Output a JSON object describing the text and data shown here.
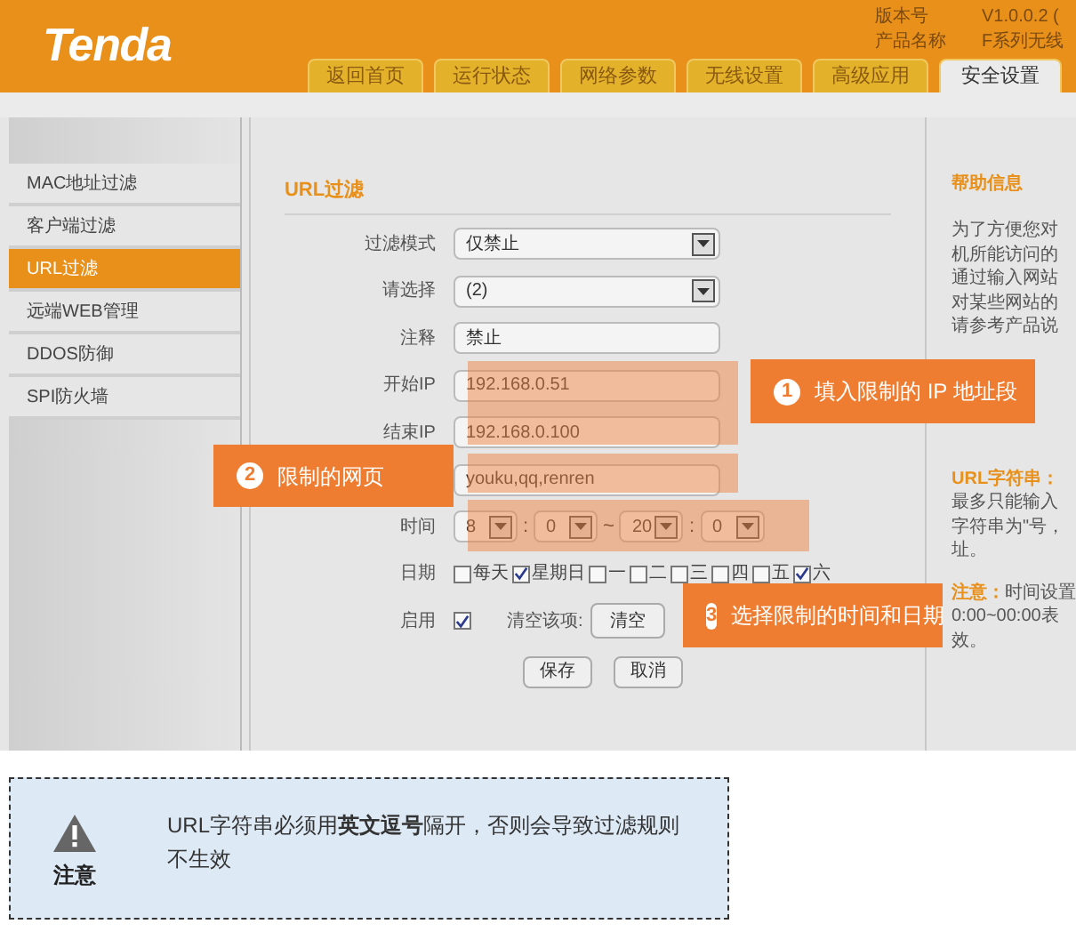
{
  "header": {
    "logo": "Tenda",
    "version_label": "版本号",
    "version": "V1.0.0.2 (",
    "product_label": "产品名称",
    "product": "F系列无线"
  },
  "tabs": [
    {
      "label": "返回首页",
      "selected": false
    },
    {
      "label": "运行状态",
      "selected": false
    },
    {
      "label": "网络参数",
      "selected": false
    },
    {
      "label": "无线设置",
      "selected": false
    },
    {
      "label": "高级应用",
      "selected": false
    },
    {
      "label": "安全设置",
      "selected": true
    }
  ],
  "sidebar": {
    "items": [
      {
        "label": "MAC地址过滤",
        "selected": false
      },
      {
        "label": "客户端过滤",
        "selected": false
      },
      {
        "label": "URL过滤",
        "selected": true
      },
      {
        "label": "远端WEB管理",
        "selected": false
      },
      {
        "label": "DDOS防御",
        "selected": false
      },
      {
        "label": "SPI防火墙",
        "selected": false
      }
    ]
  },
  "form": {
    "title": "URL过滤",
    "fields": [
      {
        "kind": "select",
        "label": "过滤模式",
        "value": "仅禁止"
      },
      {
        "kind": "select",
        "label": "请选择",
        "value": "(2)"
      },
      {
        "kind": "text",
        "label": "注释",
        "value": "禁止"
      },
      {
        "kind": "text",
        "label": "开始IP",
        "value": "192.168.0.51"
      },
      {
        "kind": "text",
        "label": "结束IP",
        "value": "192.168.0.100"
      },
      {
        "kind": "text",
        "value": "youku,qq,renren"
      },
      {
        "kind": "time",
        "label": "时间",
        "parts": [
          {
            "kind": "select",
            "value": "8"
          },
          {
            "kind": "sep",
            "value": ":"
          },
          {
            "kind": "select",
            "value": "0"
          },
          {
            "kind": "sep",
            "value": "~"
          },
          {
            "kind": "select",
            "value": "20"
          },
          {
            "kind": "sep",
            "value": ":"
          },
          {
            "kind": "select",
            "value": "0"
          }
        ]
      },
      {
        "kind": "days",
        "label": "日期",
        "days": [
          {
            "label": "每天",
            "checked": false
          },
          {
            "label": "星期日",
            "checked": true
          },
          {
            "label": "一",
            "checked": false
          },
          {
            "label": "二",
            "checked": false
          },
          {
            "label": "三",
            "checked": false
          },
          {
            "label": "四",
            "checked": false
          },
          {
            "label": "五",
            "checked": false
          },
          {
            "label": "六",
            "checked": true
          }
        ]
      },
      {
        "kind": "enable",
        "label": "启用",
        "checked": true,
        "clear_label": "清空该项:",
        "clear_button": "清空"
      }
    ],
    "buttons": [
      "保存",
      "取消"
    ]
  },
  "help": {
    "title": "帮助信息",
    "paragraphs": [
      {
        "lines": [
          "为了方便您对",
          "机所能访问的",
          "通过输入网站",
          "对某些网站的",
          "请参考产品说"
        ]
      },
      {
        "heading": "URL字符串：",
        "lines": [
          "最多只能输入",
          "字符串为\"号，",
          "址。"
        ]
      },
      {
        "heading": "注意：",
        "lines": [
          "0:00~00:00表",
          "效。"
        ],
        "first": "时间设置"
      }
    ]
  },
  "annotations": [
    {
      "number": "1",
      "text": "填入限制的 IP 地址段"
    },
    {
      "number": "2",
      "text": "限制的网页"
    },
    {
      "number": "3",
      "text": "选择限制的时间和日期"
    }
  ],
  "note": {
    "label": "注意",
    "text": "URL字符串必须用**英文逗号**隔开，否则会导致过滤规则不生效"
  }
}
